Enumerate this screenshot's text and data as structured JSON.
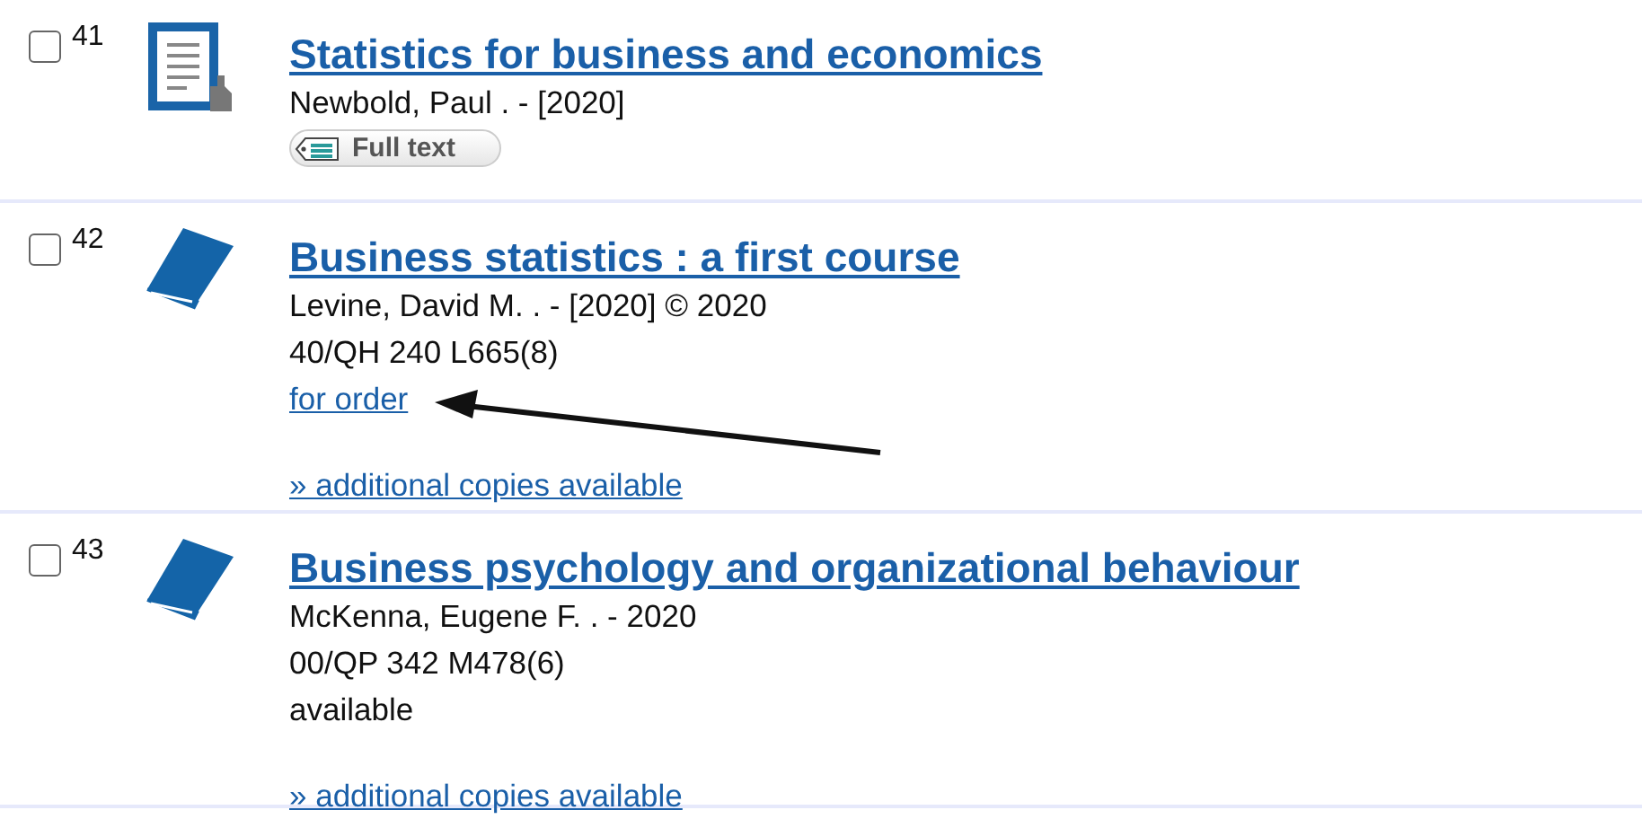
{
  "results": [
    {
      "number": "41",
      "checked": false,
      "kind": "document",
      "title": "Statistics for business and economics",
      "lines": [
        {
          "kind": "text",
          "text": "Newbold, Paul . - [2020]"
        },
        {
          "kind": "badge",
          "text": "Full text"
        }
      ]
    },
    {
      "number": "42",
      "checked": false,
      "kind": "book",
      "title": "Business statistics : a first course",
      "lines": [
        {
          "kind": "text",
          "text": "Levine, David M. . - [2020] © 2020"
        },
        {
          "kind": "text",
          "text": "40/QH 240 L665(8)"
        },
        {
          "kind": "link",
          "text": "for order"
        }
      ],
      "more_link": "» additional copies available"
    },
    {
      "number": "43",
      "checked": false,
      "kind": "book",
      "title": "Business psychology and organizational behaviour",
      "lines": [
        {
          "kind": "text",
          "text": "McKenna, Eugene F. . - 2020"
        },
        {
          "kind": "text",
          "text": "00/QP 342 M478(6)"
        },
        {
          "kind": "text",
          "text": "available"
        }
      ],
      "more_link": "» additional copies available"
    }
  ]
}
